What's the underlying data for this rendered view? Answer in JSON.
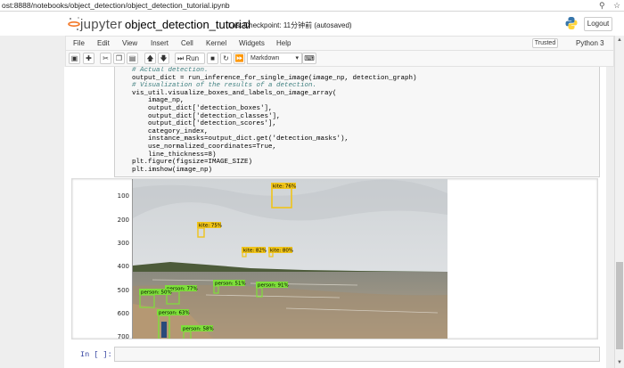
{
  "browser": {
    "url": "ost:8888/notebooks/object_detection/object_detection_tutorial.ipynb"
  },
  "header": {
    "logo_text": "jupyter",
    "notebook_title": "object_detection_tutorial",
    "checkpoint": "Last Checkpoint: 11分钟前  (autosaved)",
    "logout_label": "Logout"
  },
  "menu": {
    "items": [
      "File",
      "Edit",
      "View",
      "Insert",
      "Cell",
      "Kernel",
      "Widgets",
      "Help"
    ],
    "trusted_label": "Trusted",
    "kernel_label": "Python 3"
  },
  "toolbar": {
    "run_label": "Run",
    "cell_type": "Markdown"
  },
  "code": {
    "lines": [
      "  # Actual detection.",
      "  output_dict = run_inference_for_single_image(image_np, detection_graph)",
      "  # Visualization of the results of a detection.",
      "  vis_util.visualize_boxes_and_labels_on_image_array(",
      "      image_np,",
      "      output_dict['detection_boxes'],",
      "      output_dict['detection_classes'],",
      "      output_dict['detection_scores'],",
      "      category_index,",
      "      instance_masks=output_dict.get('detection_masks'),",
      "      use_normalized_coordinates=True,",
      "      line_thickness=8)",
      "  plt.figure(figsize=IMAGE_SIZE)",
      "  plt.imshow(image_np)"
    ]
  },
  "output": {
    "y_ticks": [
      "100",
      "200",
      "300",
      "400",
      "500",
      "600",
      "700"
    ],
    "detections": [
      {
        "label": "kite: 76%",
        "color": "#f0c419"
      },
      {
        "label": "kite: 75%",
        "color": "#f0c419"
      },
      {
        "label": "kite: 82%",
        "color": "#f0c419"
      },
      {
        "label": "kite: 80%",
        "color": "#f0c419"
      },
      {
        "label": "person: 51%",
        "color": "#7ee03a"
      },
      {
        "label": "person: 91%",
        "color": "#7ee03a"
      },
      {
        "label": "person: 50%",
        "color": "#7ee03a"
      },
      {
        "label": "person: 77%",
        "color": "#7ee03a"
      },
      {
        "label": "person: 63%",
        "color": "#7ee03a"
      },
      {
        "label": "person: 58%",
        "color": "#7ee03a"
      }
    ]
  },
  "next_cell": {
    "prompt": "In [ ]:"
  }
}
